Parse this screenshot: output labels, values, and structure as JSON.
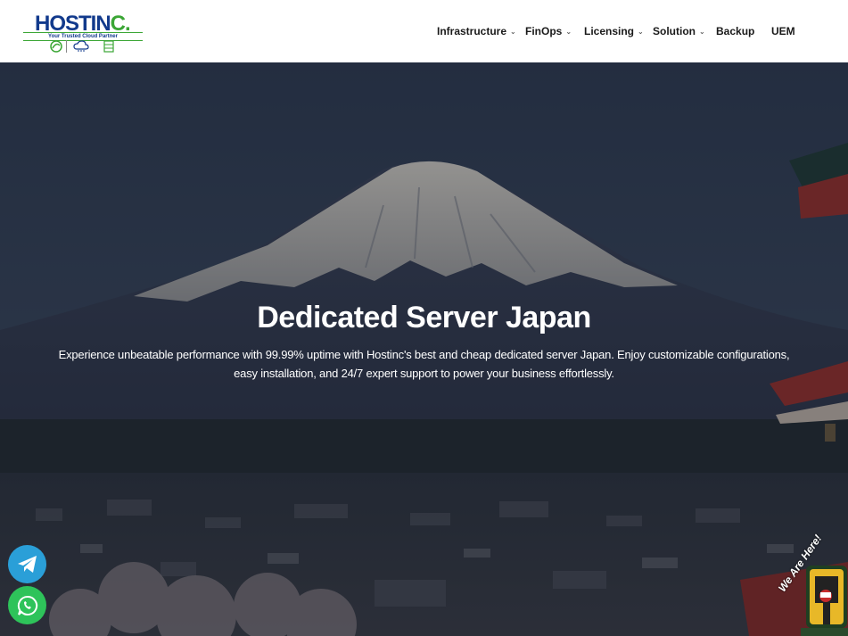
{
  "logo": {
    "brand_main": "HOSTIN",
    "brand_accent": "C.",
    "tagline": "Your Trusted Cloud Partner"
  },
  "nav": {
    "items": [
      {
        "label": "Infrastructure",
        "has_dropdown": true
      },
      {
        "label": "FinOps",
        "has_dropdown": true
      },
      {
        "label": "Licensing",
        "has_dropdown": true
      },
      {
        "label": "Solution",
        "has_dropdown": true
      },
      {
        "label": "Backup",
        "has_dropdown": false
      },
      {
        "label": "UEM",
        "has_dropdown": false
      }
    ]
  },
  "hero": {
    "title": "Dedicated Server Japan",
    "description": "Experience unbeatable performance with 99.99% uptime with Hostinc's best and cheap dedicated server Japan. Enjoy customizable configurations, easy installation, and 24/7 expert support to power your business effortlessly."
  },
  "floating": {
    "telegram_icon": "telegram-icon",
    "whatsapp_icon": "whatsapp-icon",
    "badge_text": "We Are Here!"
  },
  "colors": {
    "brand_blue": "#123a8c",
    "brand_green": "#3ba635",
    "telegram": "#2a9fd8",
    "whatsapp": "#2ec35a"
  }
}
